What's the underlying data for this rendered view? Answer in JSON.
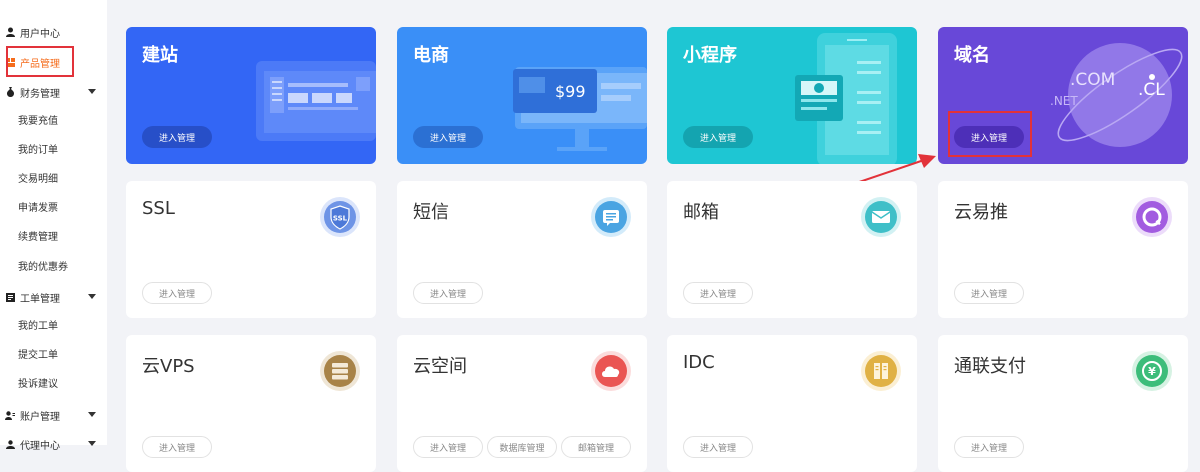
{
  "sidebar": {
    "user_center": "用户中心",
    "product_mgmt": "产品管理",
    "finance": {
      "label": "财务管理",
      "items": [
        "我要充值",
        "我的订单",
        "交易明细",
        "申请发票",
        "续费管理",
        "我的优惠券"
      ]
    },
    "ticket": {
      "label": "工单管理",
      "items": [
        "我的工单",
        "提交工单",
        "投诉建议"
      ]
    },
    "account": {
      "label": "账户管理"
    },
    "agent": {
      "label": "代理中心"
    }
  },
  "top_cards": [
    {
      "title": "建站",
      "button": "进入管理",
      "color": "#3366f5"
    },
    {
      "title": "电商",
      "button": "进入管理",
      "color": "#3a8ff7",
      "price": "$99"
    },
    {
      "title": "小程序",
      "button": "进入管理",
      "color": "#1ec6d3"
    },
    {
      "title": "域名",
      "button": "进入管理",
      "color": "#6848d8",
      "domains": [
        ".COM",
        ".CL",
        ".NET"
      ]
    }
  ],
  "cards_row1": [
    {
      "title": "SSL",
      "button": "进入管理",
      "icon": "ssl-shield-icon",
      "icon_color": "#4d79d8",
      "icon_text": "SSL"
    },
    {
      "title": "短信",
      "button": "进入管理",
      "icon": "message-icon",
      "icon_color": "#4aa4e2"
    },
    {
      "title": "邮箱",
      "button": "进入管理",
      "icon": "mail-icon",
      "icon_color": "#3fbfc8"
    },
    {
      "title": "云易推",
      "button": "进入管理",
      "icon": "push-icon",
      "icon_color": "#a25ce0"
    }
  ],
  "cards_row2": [
    {
      "title": "云VPS",
      "buttons": [
        "进入管理"
      ],
      "icon": "server-icon",
      "icon_color": "#a88348"
    },
    {
      "title": "云空间",
      "buttons": [
        "进入管理",
        "数据库管理",
        "邮箱管理"
      ],
      "icon": "cloud-icon",
      "icon_color": "#ea5553"
    },
    {
      "title": "IDC",
      "buttons": [
        "进入管理"
      ],
      "icon": "rack-icon",
      "icon_color": "#e0b144"
    },
    {
      "title": "通联支付",
      "buttons": [
        "进入管理"
      ],
      "icon": "yen-icon",
      "icon_color": "#3cbd7a",
      "icon_text": "¥"
    }
  ]
}
